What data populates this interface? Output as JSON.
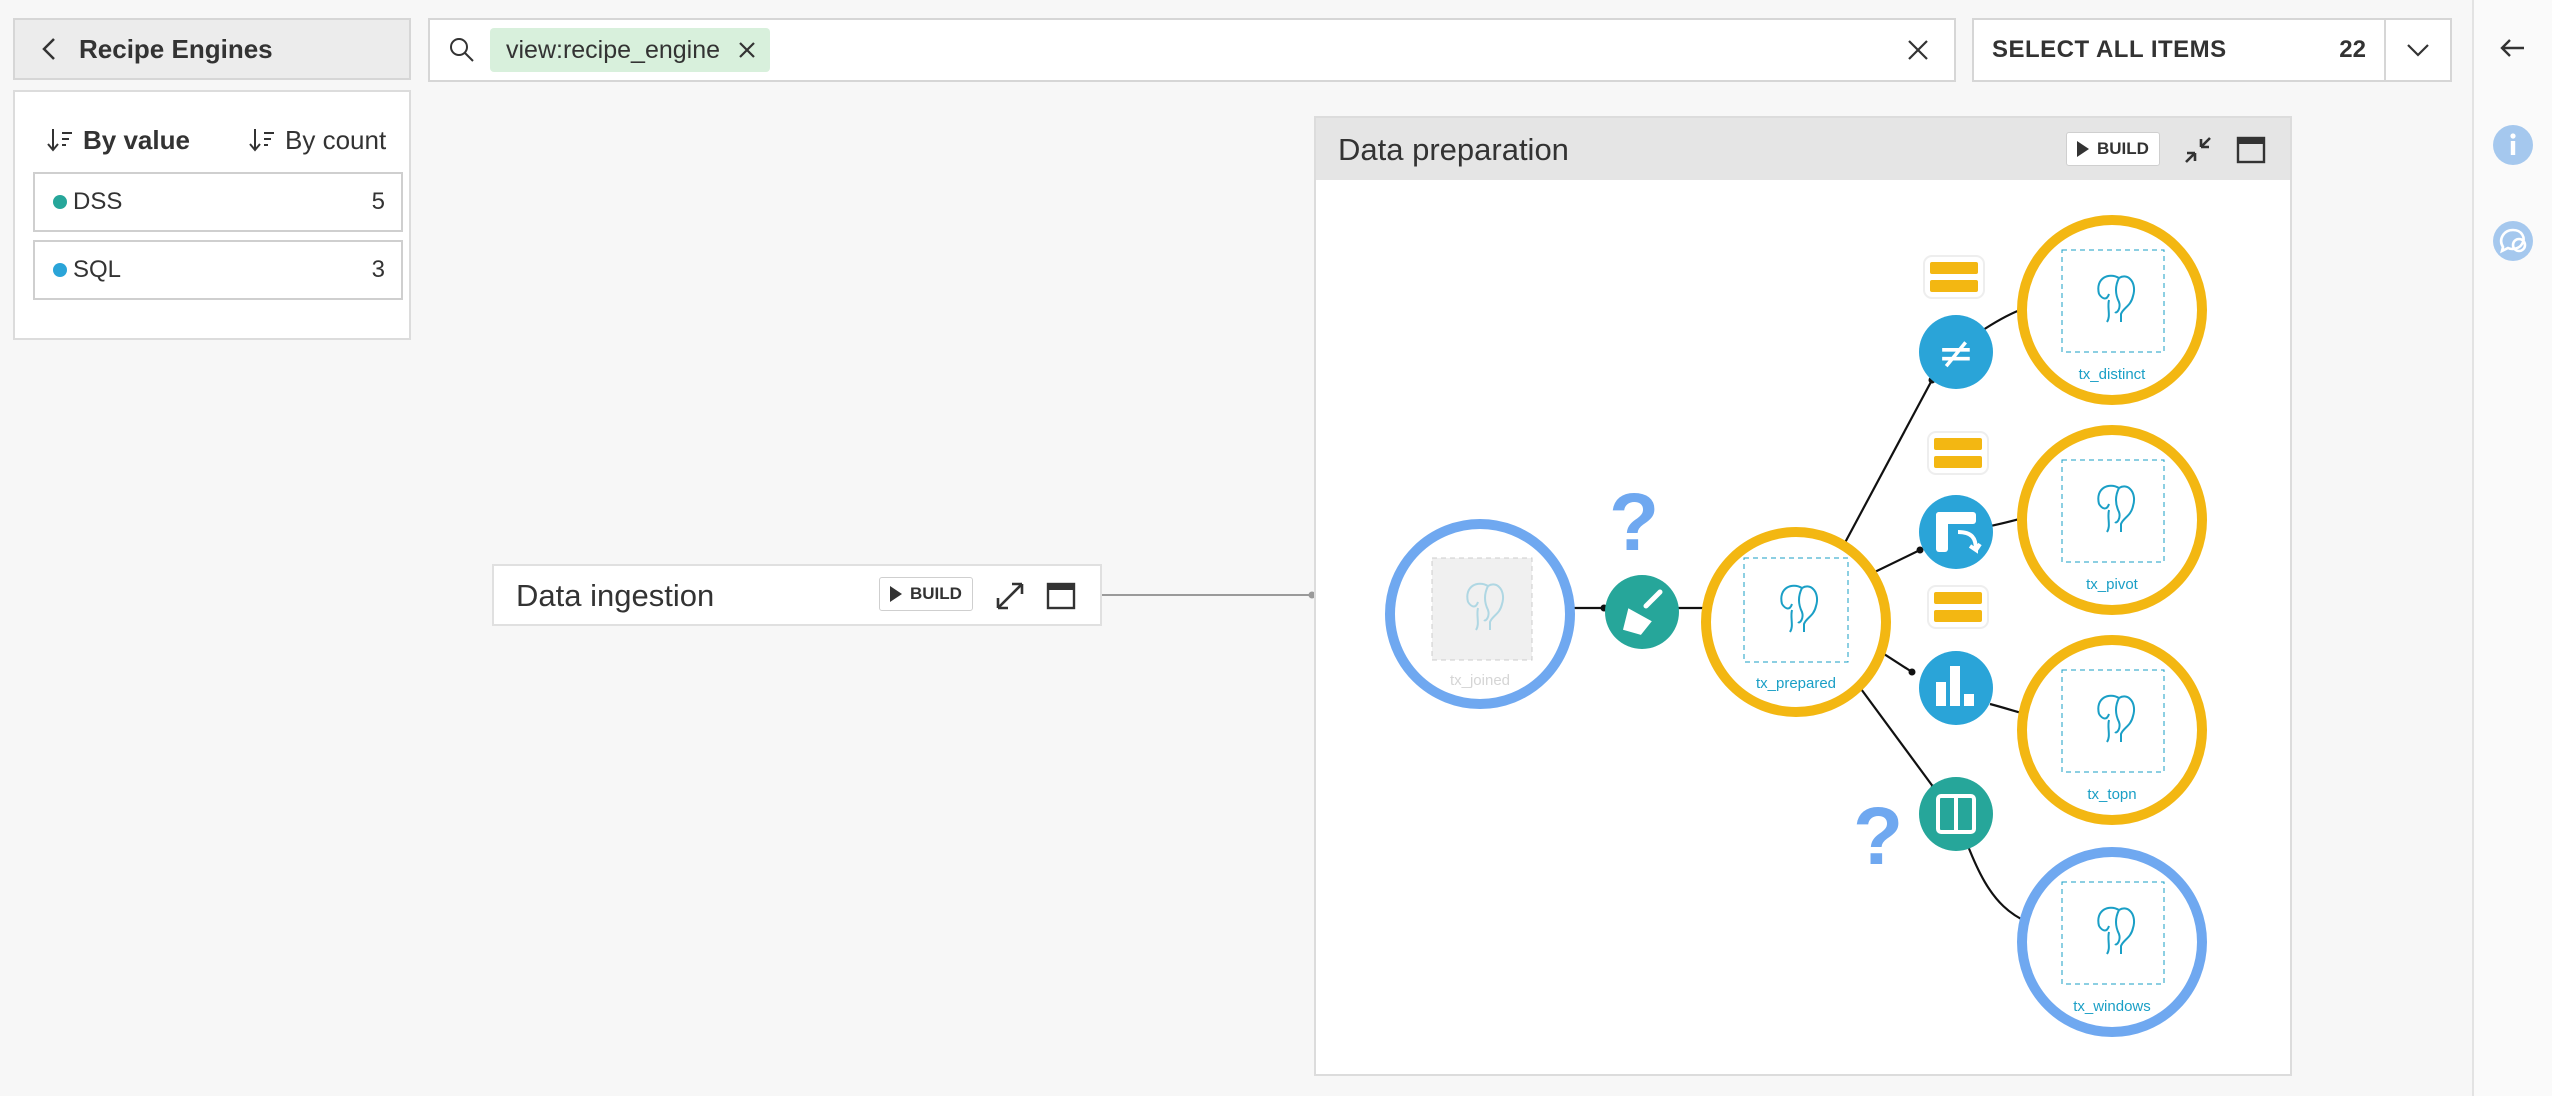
{
  "back_button": {
    "label": "Recipe Engines"
  },
  "facet": {
    "sort_by_value": "By value",
    "sort_by_count": "By count",
    "items": [
      {
        "label": "DSS",
        "count": "5",
        "color": "#26a69a"
      },
      {
        "label": "SQL",
        "count": "3",
        "color": "#2aa4d8"
      }
    ]
  },
  "search": {
    "chip": "view:recipe_engine"
  },
  "select_all": {
    "label": "SELECT ALL ITEMS",
    "count": "22"
  },
  "zones": {
    "ingestion": {
      "title": "Data ingestion",
      "build": "BUILD"
    },
    "preparation": {
      "title": "Data preparation",
      "build": "BUILD"
    }
  },
  "datasets": {
    "joined": "tx_joined",
    "prepared": "tx_prepared",
    "distinct": "tx_distinct",
    "pivot": "tx_pivot",
    "topn": "tx_topn",
    "windows": "tx_windows"
  },
  "colors": {
    "dss_engine": "#f3b712",
    "unknown_engine": "#6fa8f0",
    "recipe": "#2aa4d8",
    "recipe_teal": "#26a69a",
    "chip_bg": "#d8f0dc"
  },
  "icons": {
    "recipe_distinct": "not-equal-icon",
    "recipe_pivot": "pivot-icon",
    "recipe_topn": "topn-icon",
    "recipe_window": "window-icon",
    "recipe_prepare": "broom-icon"
  }
}
